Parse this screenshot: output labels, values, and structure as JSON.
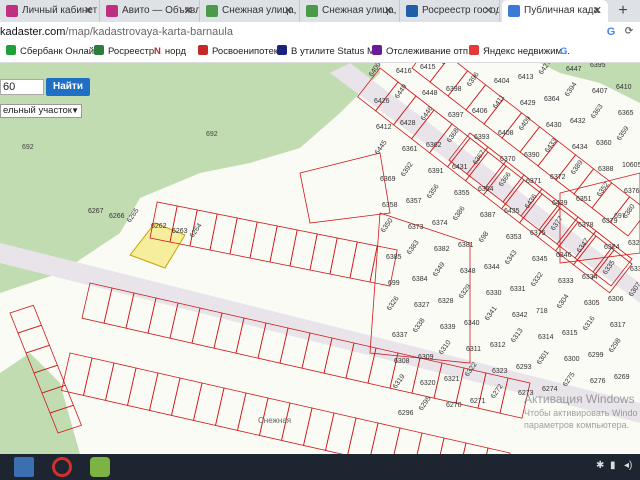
{
  "tabs": [
    {
      "label": "Личный кабинет",
      "color": "#c03080"
    },
    {
      "label": "Авито — Объявле",
      "color": "#c03080"
    },
    {
      "label": "Снежная улица, 1",
      "color": "#4a9a4a"
    },
    {
      "label": "Снежная улица, 1",
      "color": "#4a9a4a"
    },
    {
      "label": "Росреестр гос од",
      "color": "#1f5fa8"
    },
    {
      "label": "Публичная када",
      "color": "#3a7bd5"
    }
  ],
  "new_tab_symbol": "+",
  "close_symbol": "✕",
  "address": {
    "host": "kadaster.com",
    "path": "/map/kadastrovaya-karta-barnaula"
  },
  "bookmarks": [
    {
      "label": "Сбербанк Онлайн",
      "icon": "sberbank-icon",
      "color": "#21a038"
    },
    {
      "label": "Росреестр",
      "icon": "rosreestr-icon",
      "color": "#2a7d3a"
    },
    {
      "label": "норд",
      "icon": "nord-icon",
      "color": "#c62828",
      "glyph": "N"
    },
    {
      "label": "Росвоенипотека",
      "icon": "rosvoen-icon",
      "color": "#c62828"
    },
    {
      "label": "В утилите Status M...",
      "icon": "status-icon",
      "color": "#1a237e"
    },
    {
      "label": "Отслеживание отп...",
      "icon": "tracking-icon",
      "color": "#6a1b9a"
    },
    {
      "label": "Яндекс недвижим...",
      "icon": "yandex-icon",
      "color": "#e53935"
    },
    {
      "label": "",
      "icon": "google-icon",
      "color": "#4285f4",
      "glyph": "G"
    }
  ],
  "search": {
    "value": "60",
    "button_label": "Найти",
    "type_value": "ельный участок"
  },
  "map_labels": {
    "area_left": "692",
    "area_left2": "692",
    "area_right": "697",
    "street": "Снежная"
  },
  "parcel_numbers": [
    "6400",
    "6416",
    "6415",
    "6425",
    "6450",
    "6451",
    "6399",
    "6401",
    "6402",
    "6403",
    "6414",
    "6426",
    "6449",
    "6448",
    "6398",
    "6396",
    "6404",
    "6413",
    "6427",
    "6447",
    "6395",
    "6405",
    "6412",
    "6428",
    "6446",
    "6397",
    "6406",
    "6411",
    "6429",
    "6364",
    "6394",
    "6407",
    "6410",
    "6445",
    "6361",
    "6362",
    "6368",
    "6393",
    "6408",
    "6409",
    "6430",
    "6432",
    "6363",
    "6365",
    "6369",
    "6392",
    "6391",
    "6431",
    "6367",
    "6370",
    "6390",
    "6433",
    "6434",
    "6360",
    "6359",
    "6358",
    "6357",
    "6356",
    "6355",
    "6354",
    "6366",
    "6371",
    "6372",
    "6389",
    "6388",
    "10605/2",
    "6350",
    "6373",
    "6374",
    "6386",
    "6387",
    "6435",
    "6436",
    "6439",
    "6351",
    "6352",
    "6376",
    "6385",
    "6383",
    "6382",
    "6381",
    "698",
    "6353",
    "6375",
    "6377",
    "6378",
    "6379",
    "6380",
    "699",
    "6384",
    "6349",
    "6348",
    "6344",
    "6343",
    "6345",
    "6346",
    "6347",
    "6324",
    "6325",
    "6326",
    "6327",
    "6328",
    "6329",
    "6330",
    "6331",
    "6332",
    "6333",
    "6334",
    "6335",
    "6336",
    "6337",
    "6338",
    "6339",
    "6340",
    "6341",
    "6342",
    "718",
    "6304",
    "6305",
    "6306",
    "6307",
    "6308",
    "6309",
    "6310",
    "6311",
    "6312",
    "6313",
    "6314",
    "6315",
    "6316",
    "6317",
    "6318",
    "6319",
    "6320",
    "6321",
    "6322",
    "6323",
    "6293",
    "6301",
    "6300",
    "6299",
    "6298",
    "6297",
    "6296",
    "6295",
    "6270",
    "6271",
    "6272",
    "6273",
    "6274",
    "6275",
    "6276",
    "6269",
    "6268",
    "6267",
    "6266",
    "6265",
    "6262",
    "6263",
    "6264"
  ],
  "watermark": {
    "line1": "Активация Windows",
    "line2": "Чтобы активировать Windo",
    "line3": "параметров компьютера."
  },
  "taskbar": {
    "apps": [
      {
        "icon": "calculator-icon",
        "color": "#3a6fb0"
      },
      {
        "icon": "opera-icon",
        "color": "#d32f2f"
      },
      {
        "icon": "paint-icon",
        "color": "#7cb342"
      }
    ]
  },
  "colors": {
    "forest": "#c2dcb2",
    "parcel_line": "#d01818",
    "highlight": "#f6ee9c",
    "road": "#e8e4ea"
  }
}
